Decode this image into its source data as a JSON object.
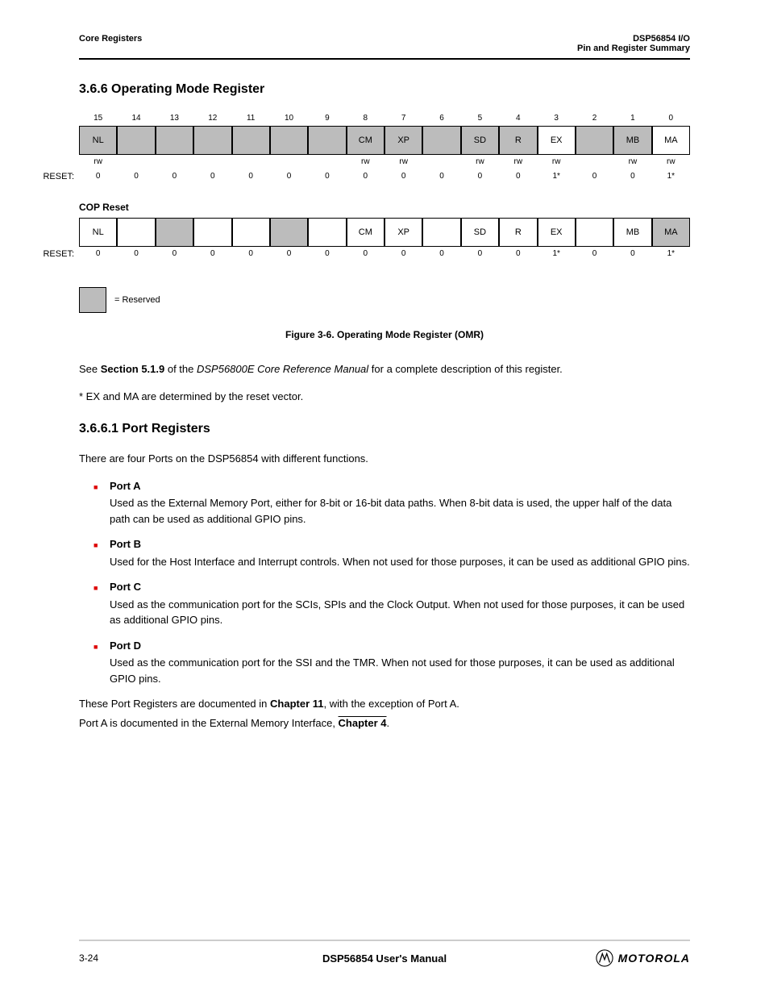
{
  "header": {
    "left_line": "Core Registers",
    "right_line1": "DSP56854 I/O",
    "right_line2": "Pin and Register Summary"
  },
  "section_title": "3.6.6   Operating Mode Register",
  "bits_high": {
    "nums": [
      "15",
      "14",
      "13",
      "12",
      "11",
      "10",
      "9",
      "8",
      "7",
      "6",
      "5",
      "4",
      "3",
      "2",
      "1",
      "0"
    ],
    "cells": [
      {
        "t": "NL",
        "g": true
      },
      {
        "t": "",
        "g": true
      },
      {
        "t": "",
        "g": true
      },
      {
        "t": "",
        "g": true
      },
      {
        "t": "",
        "g": true
      },
      {
        "t": "",
        "g": true
      },
      {
        "t": "",
        "g": true
      },
      {
        "t": "CM",
        "g": true
      },
      {
        "t": "XP",
        "g": true
      },
      {
        "t": "",
        "g": true
      },
      {
        "t": "SD",
        "g": true
      },
      {
        "t": "R",
        "g": true
      },
      {
        "t": "EX",
        "g": false
      },
      {
        "t": "",
        "g": true
      },
      {
        "t": "MB",
        "g": true
      },
      {
        "t": "MA",
        "g": false
      }
    ],
    "types": [
      "rw",
      "",
      "",
      "",
      "",
      "",
      "",
      "rw",
      "rw",
      "",
      "rw",
      "rw",
      "rw",
      "",
      "rw",
      "rw"
    ],
    "reset": [
      "0",
      "0",
      "0",
      "0",
      "0",
      "0",
      "0",
      "0",
      "0",
      "0",
      "0",
      "0",
      "1*",
      "0",
      "0",
      "1*"
    ]
  },
  "bits_low": {
    "title": "COP Reset",
    "cells": [
      {
        "t": "NL",
        "g": false
      },
      {
        "t": "",
        "g": false
      },
      {
        "t": "",
        "g": true
      },
      {
        "t": "",
        "g": false
      },
      {
        "t": "",
        "g": false
      },
      {
        "t": "",
        "g": true
      },
      {
        "t": "",
        "g": false
      },
      {
        "t": "CM",
        "g": false
      },
      {
        "t": "XP",
        "g": false
      },
      {
        "t": "",
        "g": false
      },
      {
        "t": "SD",
        "g": false
      },
      {
        "t": "R",
        "g": false
      },
      {
        "t": "EX",
        "g": false
      },
      {
        "t": "",
        "g": false
      },
      {
        "t": "MB",
        "g": false
      },
      {
        "t": "MA",
        "g": true
      }
    ],
    "reset": [
      "0",
      "0",
      "0",
      "0",
      "0",
      "0",
      "0",
      "0",
      "0",
      "0",
      "0",
      "0",
      "1*",
      "0",
      "0",
      "1*"
    ]
  },
  "legend_text": "= Reserved",
  "figure_caption": "Figure 3-6.   Operating Mode Register (OMR)",
  "intro": "See Section 5.1.9 of the DSP56800E Core Reference Manual for a complete description of this register.",
  "footnote": "* EX and MA are determined by the reset vector.",
  "ports_heading": "3.6.6.1   Port Registers",
  "ports_intro": "There are four Ports on the DSP56854 with different functions.",
  "ports": [
    {
      "name": "Port A",
      "desc": "Used as the External Memory Port, either for 8-bit or 16-bit data paths. When 8-bit data is used, the upper half of the data path can be used as additional GPIO pins."
    },
    {
      "name": "Port B",
      "desc": "Used for the Host Interface and Interrupt controls. When not used for those purposes, it can be used as additional GPIO pins."
    },
    {
      "name": "Port C",
      "desc": "Used as the communication port for the SCIs, SPIs and the Clock Output. When not used for those purposes, it can be used as additional GPIO pins."
    },
    {
      "name": "Port D",
      "desc": "Used as the communication port for the SSI and the TMR. When not used for those purposes, it can be used as additional GPIO pins."
    }
  ],
  "ports_ref_prefix": "These Port Registers are documented in ",
  "ports_ref_chapter": "Chapter 11",
  "ports_ref_suffix": ", with the exception of Port A.",
  "ports_ref2": "Port A is documented in the External Memory Interface, Chapter 4.",
  "footer": {
    "page": "3-24",
    "title": "DSP56854 User's Manual",
    "brand": "MOTOROLA"
  }
}
